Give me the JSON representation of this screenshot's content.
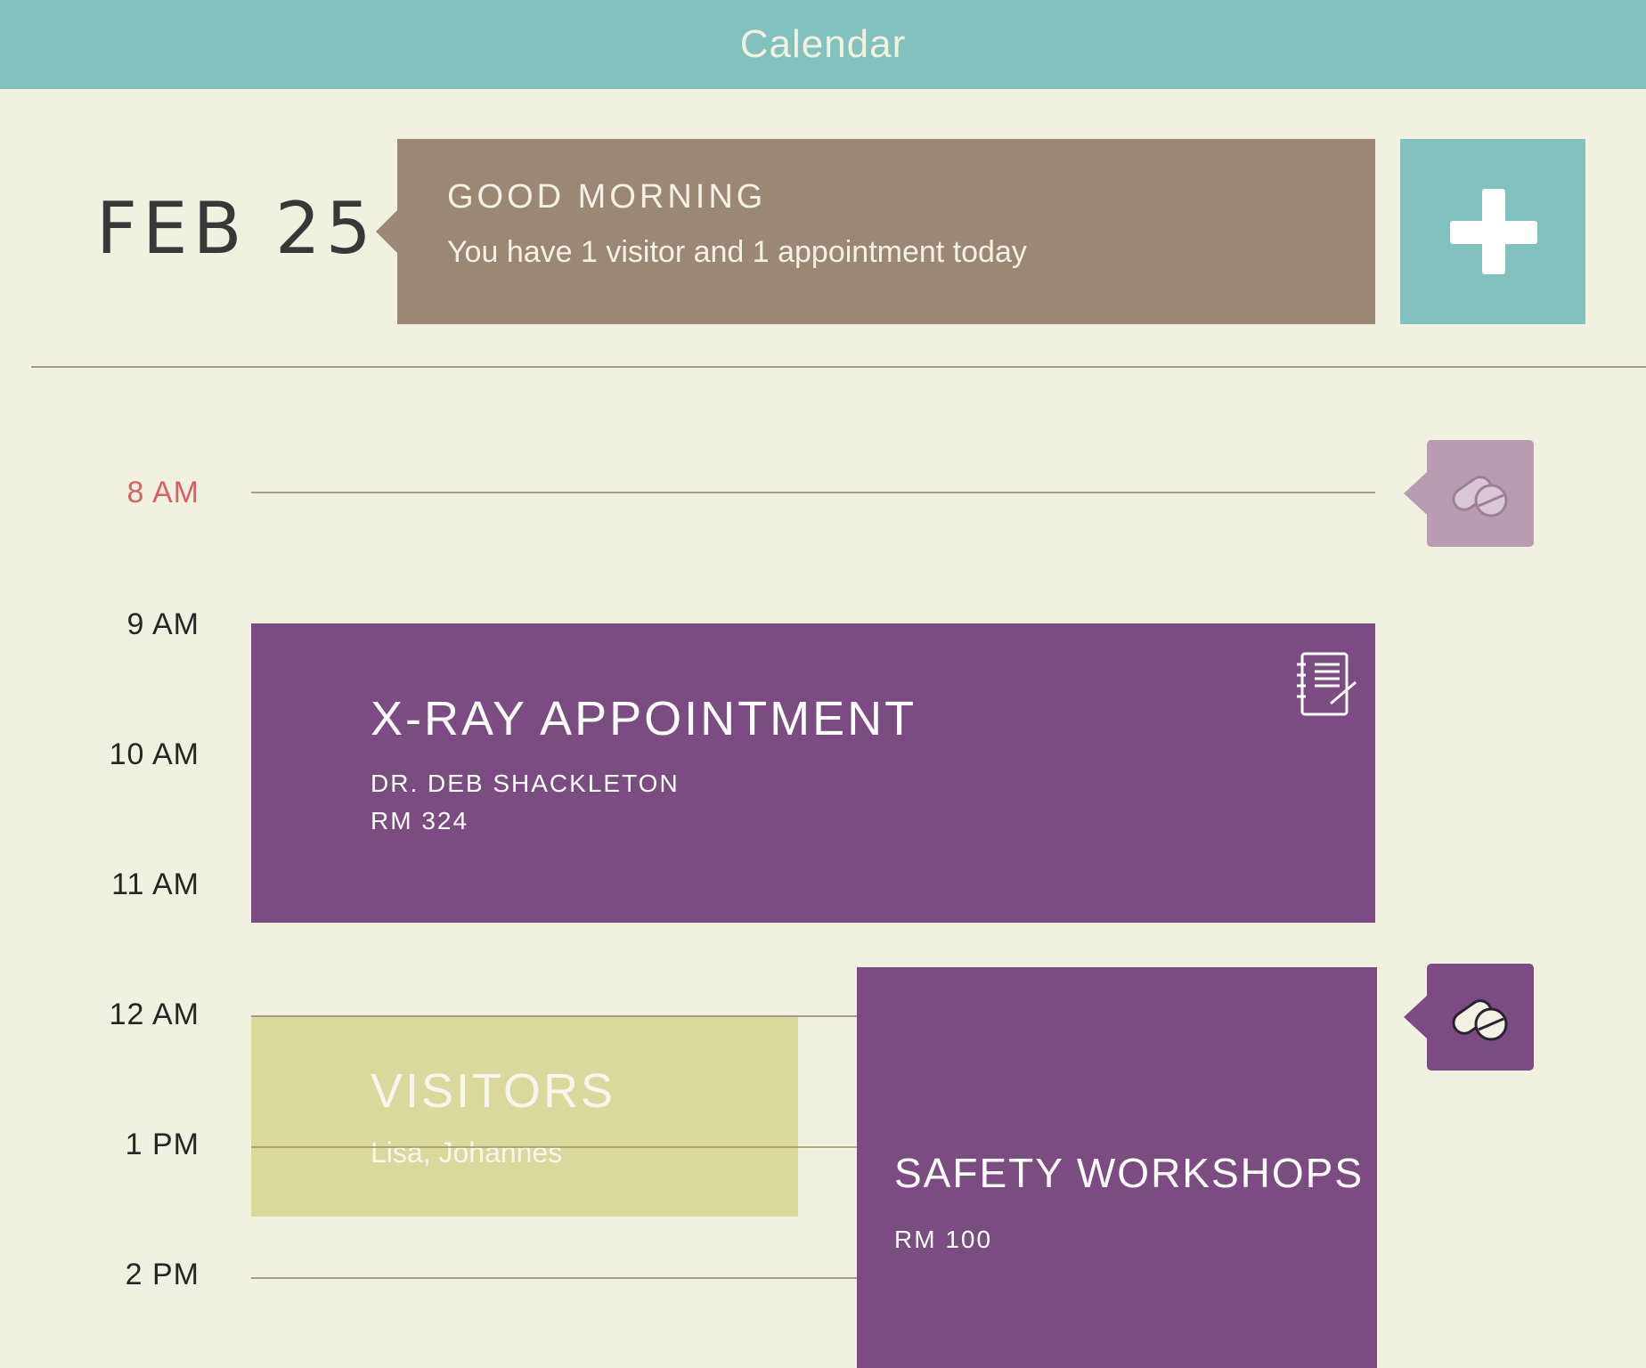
{
  "header": {
    "title": "Calendar"
  },
  "date": {
    "label": "FEB 25"
  },
  "greeting": {
    "title": "GOOD MORNING",
    "subtitle": "You have 1 visitor and 1 appointment today"
  },
  "timeline": {
    "current_hour": "8 AM",
    "hours": [
      "8 AM",
      "9 AM",
      "10 AM",
      "11 AM",
      "12 AM",
      "1 PM",
      "2 PM"
    ]
  },
  "events": [
    {
      "title": "X-RAY APPOINTMENT",
      "doctor": "DR. DEB SHACKLETON",
      "room": "RM 324",
      "color": "#7b4c82",
      "icon": "notebook-icon"
    },
    {
      "title": "VISITORS",
      "names": "Lisa, Johannes",
      "color": "#d9d99c"
    },
    {
      "title": "SAFETY WORKSHOPS",
      "room": "RM 100",
      "color": "#7b4c82"
    }
  ],
  "medication_reminders": [
    {
      "time": "8 AM",
      "icon": "pill-icon",
      "color": "#b89cb2"
    },
    {
      "time": "12 AM",
      "icon": "pill-icon",
      "color": "#7b4c82"
    }
  ],
  "colors": {
    "header": "#81c1be",
    "background": "#f1f1e1",
    "greeting": "#9a8775",
    "current_time": "#d9605e"
  }
}
